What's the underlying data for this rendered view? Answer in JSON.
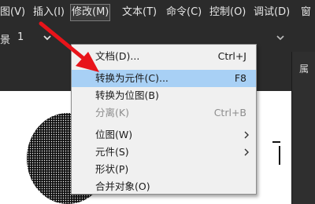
{
  "menubar": {
    "items": [
      {
        "label": "图(V)"
      },
      {
        "label": "插入(I)"
      },
      {
        "label": "修改(M)"
      },
      {
        "label": "文本(T)"
      },
      {
        "label": "命令(C)"
      },
      {
        "label": "控制(O)"
      },
      {
        "label": "调试(D)"
      },
      {
        "label": "窗"
      }
    ]
  },
  "toolbar": {
    "scene_label": "景",
    "scene_number": "1"
  },
  "right_panel": {
    "label": "属"
  },
  "dropdown": {
    "items": [
      {
        "label": "文档(D)...",
        "shortcut": "Ctrl+J"
      },
      {
        "label": "转换为元件(C)...",
        "shortcut": "F8"
      },
      {
        "label": "转换为位图(B)",
        "shortcut": ""
      },
      {
        "label": "分离(K)",
        "shortcut": "Ctrl+B"
      },
      {
        "label": "位图(W)",
        "shortcut": ""
      },
      {
        "label": "元件(S)",
        "shortcut": ""
      },
      {
        "label": "形状(P)",
        "shortcut": ""
      },
      {
        "label": "合并对象(O)",
        "shortcut": ""
      }
    ]
  },
  "colors": {
    "highlight": "#a8d0f5",
    "arrow": "#e8141a",
    "app_bg": "#2b2b2b",
    "menu_bg": "#f0f0f0"
  }
}
